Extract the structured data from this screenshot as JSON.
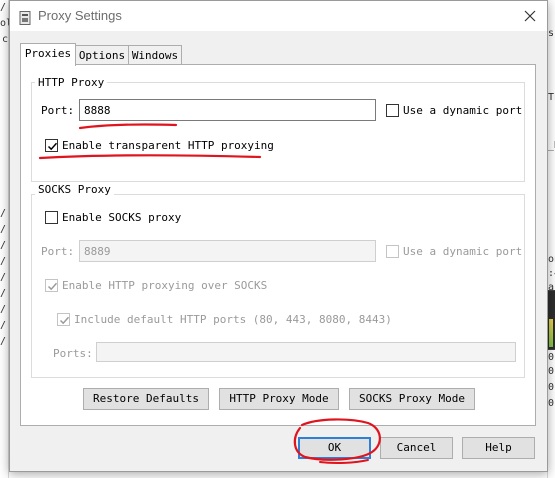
{
  "window": {
    "title": "Proxy Settings",
    "app_icon": "fiddler-app-icon",
    "close_icon": "close-icon"
  },
  "tabs": [
    {
      "label": "Proxies",
      "active": true
    },
    {
      "label": "Options",
      "active": false
    },
    {
      "label": "Windows",
      "active": false
    }
  ],
  "http_proxy": {
    "group_title": "HTTP Proxy",
    "port_label": "Port:",
    "port_value": "8888",
    "dynamic_port_label": "Use a dynamic port",
    "dynamic_port_checked": false,
    "transparent_label": "Enable transparent HTTP proxying",
    "transparent_checked": true
  },
  "socks_proxy": {
    "group_title": "SOCKS Proxy",
    "enable_label": "Enable SOCKS proxy",
    "enable_checked": false,
    "port_label": "Port:",
    "port_value": "8889",
    "dynamic_port_label": "Use a dynamic port",
    "http_over_socks_label": "Enable HTTP proxying over SOCKS",
    "http_over_socks_checked": true,
    "include_ports_label": "Include default HTTP ports (80, 443, 8080, 8443)",
    "include_ports_checked": true,
    "ports_label": "Ports:",
    "ports_value": ""
  },
  "mode_buttons": {
    "restore": "Restore Defaults",
    "http_mode": "HTTP Proxy Mode",
    "socks_mode": "SOCKS Proxy Mode"
  },
  "dialog_buttons": {
    "ok": "OK",
    "cancel": "Cancel",
    "help": "Help"
  },
  "background_glyphs": {
    "left": [
      "/",
      "ol",
      "c",
      "/",
      "/",
      "/",
      "/",
      "/",
      "/",
      "/",
      "/",
      "/"
    ],
    "right": [
      "sc",
      "TE",
      "_R",
      "on",
      ":4",
      "ar",
      "0:",
      "0:",
      "0:",
      "0:"
    ]
  },
  "annotation_color": "#e0141e"
}
